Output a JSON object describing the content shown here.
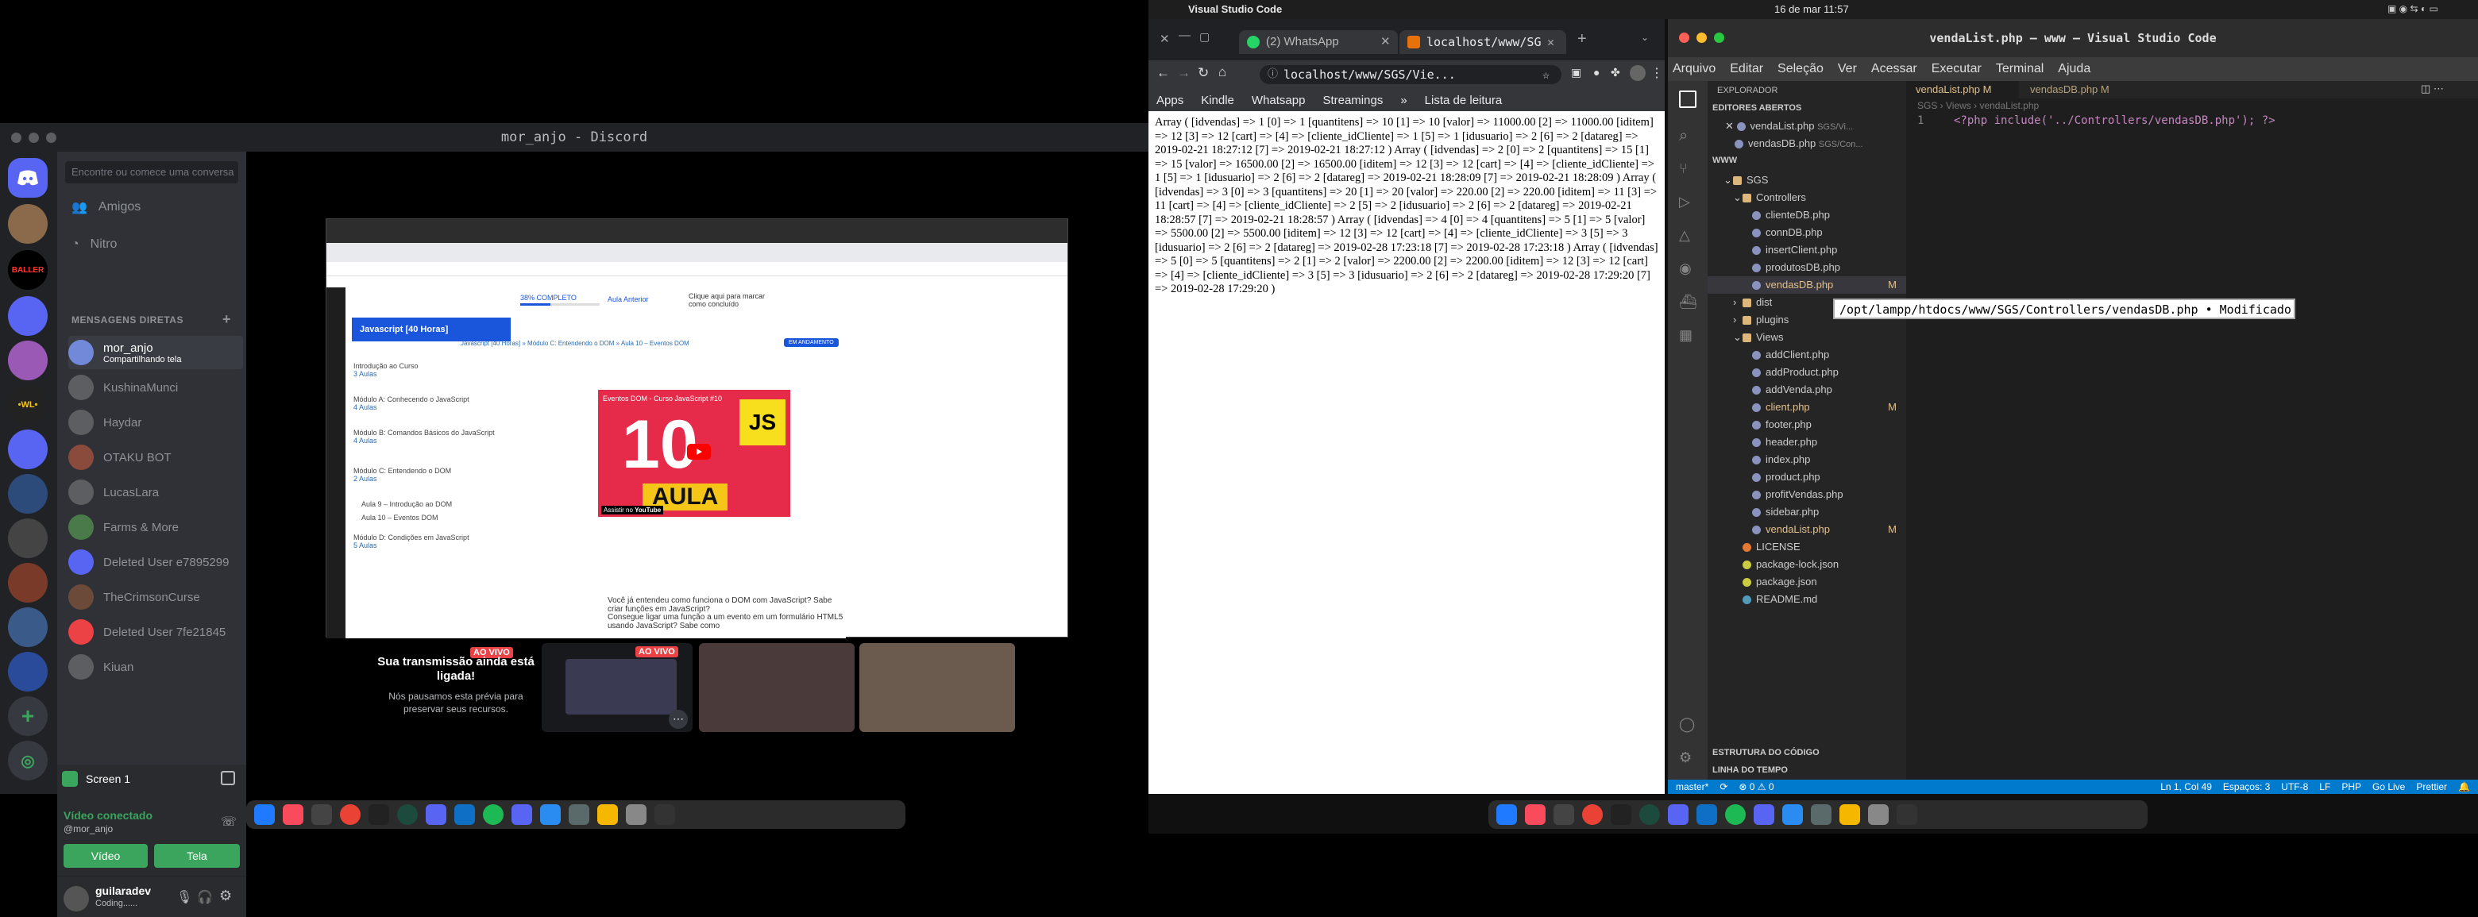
{
  "discord": {
    "window_title": "mor_anjo - Discord",
    "search_placeholder": "Encontre ou comece uma conversa",
    "nav": [
      "Amigos",
      "Nitro"
    ],
    "dm_header": "MENSAGENS DIRETAS",
    "dms": [
      {
        "name": "mor_anjo",
        "status": "Compartilhando tela",
        "active": true,
        "color": "#7289da"
      },
      {
        "name": "KushinaMunci",
        "status": "",
        "active": false,
        "color": "#5c5e62"
      },
      {
        "name": "Haydar",
        "status": "",
        "active": false,
        "color": "#5c5e62"
      },
      {
        "name": "OTAKU BOT",
        "status": "",
        "active": false,
        "color": "#8a4b3c"
      },
      {
        "name": "LucasLara",
        "status": "",
        "active": false,
        "color": "#5c5e62"
      },
      {
        "name": "Farms & More",
        "status": "",
        "active": false,
        "color": "#4a7a4a"
      },
      {
        "name": "Deleted User e7895299",
        "status": "",
        "active": false,
        "color": "#5865f2"
      },
      {
        "name": "TheCrimsonCurse",
        "status": "",
        "active": false,
        "color": "#6b4a3a"
      },
      {
        "name": "Deleted User 7fe21845",
        "status": "",
        "active": false,
        "color": "#ed4245"
      },
      {
        "name": "Kiuan",
        "status": "",
        "active": false,
        "color": "#5c5e62"
      }
    ],
    "voice": {
      "screen_label": "Screen 1",
      "connected_label": "Vídeo conectado",
      "connected_user": "@mor_anjo",
      "video_btn": "Vídeo",
      "screen_btn": "Tela"
    },
    "user": {
      "name": "guilaradev",
      "status": "Coding......"
    },
    "stream_notice": {
      "live": "AO VIVO",
      "title": "Sua transmissão ainda está ligada!",
      "body": "Nós pausamos esta prévia para preservar seus recursos."
    },
    "thumb_live": "AO VIVO"
  },
  "shared_screen": {
    "module_header": "Javascript [40 Horas]",
    "breadcrumb": "Javascript [40 Horas] » Módulo C: Entendendo o DOM » Aula 10 – Eventos DOM",
    "badge": "EM ANDAMENTO",
    "progress": "38% COMPLETO",
    "prev": "Aula Anterior",
    "mark_done": "Clique aqui para marcar como concluído",
    "modules": [
      {
        "title": "Introdução ao Curso",
        "count": "3 Aulas"
      },
      {
        "title": "Módulo A: Conhecendo o JavaScript",
        "count": "4 Aulas"
      },
      {
        "title": "Módulo B: Comandos Básicos do JavaScript",
        "count": "4 Aulas"
      },
      {
        "title": "Módulo C: Entendendo o DOM",
        "count": "2 Aulas"
      },
      {
        "title": "Aula 9 – Introdução ao DOM",
        "count": ""
      },
      {
        "title": "Aula 10 – Eventos DOM",
        "count": ""
      },
      {
        "title": "Módulo D: Condições em JavaScript",
        "count": "5 Aulas"
      }
    ],
    "video": {
      "title": "Eventos DOM - Curso JavaScript #10",
      "big_number": "10",
      "js": "JS",
      "aula": "AULA",
      "watch_on": "Assistir no",
      "yt": "YouTube"
    },
    "desc_1": "Você já entendeu como funciona o DOM com JavaScript? Sabe criar funções em JavaScript?",
    "desc_2": "Consegue ligar uma função a um evento em um formulário HTML5 usando JavaScript? Sabe como"
  },
  "menubar": {
    "app": "Visual Studio Code",
    "datetime": "16 de mar  11:57"
  },
  "chrome": {
    "tabs": [
      "(2) WhatsApp",
      "localhost/www/SG"
    ],
    "url": "localhost/www/SGS/Vie...",
    "bookmarks": [
      "Apps",
      "Kindle",
      "Whatsapp",
      "Streamings",
      "»",
      "Lista de leitura"
    ],
    "body": "Array ( [idvendas] => 1 [0] => 1 [quantitens] => 10 [1] => 10 [valor] => 11000.00 [2] => 11000.00 [iditem] => 12 [3] => 12 [cart] => [4] => [cliente_idCliente] => 1 [5] => 1 [idusuario] => 2 [6] => 2 [datareg] => 2019-02-21 18:27:12 [7] => 2019-02-21 18:27:12 ) Array ( [idvendas] => 2 [0] => 2 [quantitens] => 15 [1] => 15 [valor] => 16500.00 [2] => 16500.00 [iditem] => 12 [3] => 12 [cart] => [4] => [cliente_idCliente] => 1 [5] => 1 [idusuario] => 2 [6] => 2 [datareg] => 2019-02-21 18:28:09 [7] => 2019-02-21 18:28:09 ) Array ( [idvendas] => 3 [0] => 3 [quantitens] => 20 [1] => 20 [valor] => 220.00 [2] => 220.00 [iditem] => 11 [3] => 11 [cart] => [4] => [cliente_idCliente] => 2 [5] => 2 [idusuario] => 2 [6] => 2 [datareg] => 2019-02-21 18:28:57 [7] => 2019-02-21 18:28:57 ) Array ( [idvendas] => 4 [0] => 4 [quantitens] => 5 [1] => 5 [valor] => 5500.00 [2] => 5500.00 [iditem] => 12 [3] => 12 [cart] => [4] => [cliente_idCliente] => 3 [5] => 3 [idusuario] => 2 [6] => 2 [datareg] => 2019-02-28 17:23:18 [7] => 2019-02-28 17:23:18 ) Array ( [idvendas] => 5 [0] => 5 [quantitens] => 2 [1] => 2 [valor] => 2200.00 [2] => 2200.00 [iditem] => 12 [3] => 12 [cart] => [4] => [cliente_idCliente] => 3 [5] => 3 [idusuario] => 2 [6] => 2 [datareg] => 2019-02-28 17:29:20 [7] => 2019-02-28 17:29:20 )"
  },
  "vscode": {
    "title": "vendaList.php — www — Visual Studio Code",
    "menu": [
      "Arquivo",
      "Editar",
      "Seleção",
      "Ver",
      "Acessar",
      "Executar",
      "Terminal",
      "Ajuda"
    ],
    "explorer_title": "EXPLORADOR",
    "open_editors": "EDITORES ABERTOS",
    "open_files": [
      {
        "name": "vendaList.php",
        "path": "SGS/Vi..."
      },
      {
        "name": "vendasDB.php",
        "path": "SGS/Con..."
      }
    ],
    "workspace": "WWW",
    "tree": [
      {
        "name": "SGS",
        "level": 1,
        "type": "folder"
      },
      {
        "name": "Controllers",
        "level": 2,
        "type": "folder"
      },
      {
        "name": "clienteDB.php",
        "level": 3,
        "type": "php"
      },
      {
        "name": "connDB.php",
        "level": 3,
        "type": "php"
      },
      {
        "name": "insertClient.php",
        "level": 3,
        "type": "php"
      },
      {
        "name": "produtosDB.php",
        "level": 3,
        "type": "php"
      },
      {
        "name": "vendasDB.php",
        "level": 3,
        "type": "php-mod"
      },
      {
        "name": "dist",
        "level": 2,
        "type": "folder-c"
      },
      {
        "name": "plugins",
        "level": 2,
        "type": "folder-c"
      },
      {
        "name": "Views",
        "level": 2,
        "type": "folder"
      },
      {
        "name": "addClient.php",
        "level": 3,
        "type": "php"
      },
      {
        "name": "addProduct.php",
        "level": 3,
        "type": "php"
      },
      {
        "name": "addVenda.php",
        "level": 3,
        "type": "php"
      },
      {
        "name": "client.php",
        "level": 3,
        "type": "php-mod"
      },
      {
        "name": "footer.php",
        "level": 3,
        "type": "php"
      },
      {
        "name": "header.php",
        "level": 3,
        "type": "php"
      },
      {
        "name": "index.php",
        "level": 3,
        "type": "php"
      },
      {
        "name": "product.php",
        "level": 3,
        "type": "php"
      },
      {
        "name": "profitVendas.php",
        "level": 3,
        "type": "php"
      },
      {
        "name": "sidebar.php",
        "level": 3,
        "type": "php"
      },
      {
        "name": "vendaList.php",
        "level": 3,
        "type": "php-mod"
      },
      {
        "name": "LICENSE",
        "level": 2,
        "type": "lic"
      },
      {
        "name": "package-lock.json",
        "level": 2,
        "type": "json"
      },
      {
        "name": "package.json",
        "level": 2,
        "type": "json"
      },
      {
        "name": "README.md",
        "level": 2,
        "type": "md"
      }
    ],
    "outline": "ESTRUTURA DO CÓDIGO",
    "timeline": "LINHA DO TEMPO",
    "editor_tabs": [
      "vendaList.php M",
      "vendasDB.php M"
    ],
    "breadcrumb": "SGS › Views › vendaList.php",
    "line_no": "1",
    "code": "<?php include('../Controllers/vendasDB.php'); ?>",
    "tooltip": "/opt/lampp/htdocs/www/SGS/Controllers/vendasDB.php • Modificado",
    "status": {
      "branch": "master*",
      "problems": "⊗ 0 ⚠ 0",
      "position": "Ln 1, Col 49",
      "spaces": "Espaços: 3",
      "encoding": "UTF-8",
      "eol": "LF",
      "lang": "PHP",
      "golive": "Go Live",
      "prettier": "Prettier"
    }
  }
}
